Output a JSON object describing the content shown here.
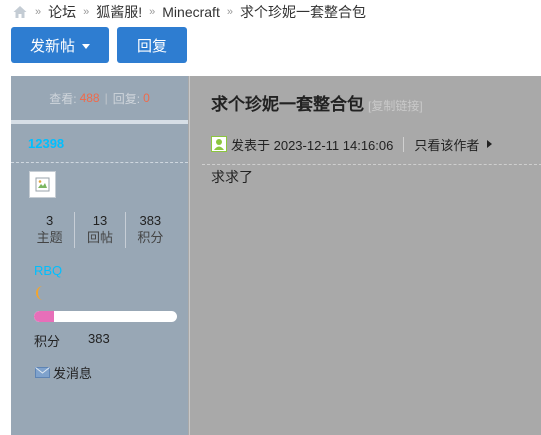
{
  "breadcrumb": {
    "items": [
      "论坛",
      "狐酱服!",
      "Minecraft",
      "求个珍妮一套整合包"
    ],
    "separator": "»"
  },
  "actions": {
    "new_post": "发新帖",
    "reply": "回复"
  },
  "thread_stats": {
    "views_label": "查看:",
    "views": "488",
    "replies_label": "回复:",
    "replies": "0"
  },
  "author": {
    "name": "12398",
    "stats": [
      {
        "value": "3",
        "label": "主题"
      },
      {
        "value": "13",
        "label": "回帖"
      },
      {
        "value": "383",
        "label": "积分"
      }
    ],
    "group": "RBQ",
    "level_progress": 0.14,
    "points_label": "积分",
    "points_value": "383",
    "send_message": "发消息"
  },
  "post": {
    "title": "求个珍妮一套整合包",
    "copy_link": "[复制链接]",
    "posted_at": "发表于 2023-12-11 14:16:06",
    "only_author": "只看该作者",
    "body": "求求了"
  },
  "colors": {
    "button": "#2e7dd1",
    "username": "#00bfff",
    "stat_number": "#f06a4a",
    "progress_fill": "#e76fb9"
  }
}
